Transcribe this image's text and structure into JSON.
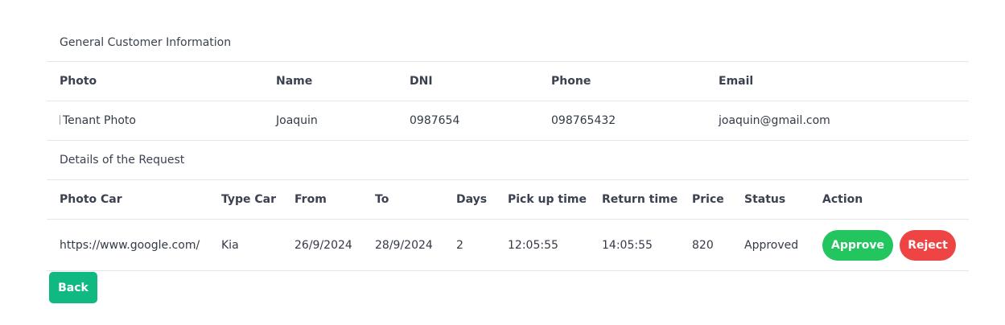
{
  "customer_section": {
    "title": "General Customer Information",
    "headers": {
      "photo": "Photo",
      "name": "Name",
      "dni": "DNI",
      "phone": "Phone",
      "email": "Email"
    },
    "values": {
      "photo_alt": "Tenant Photo",
      "name": "Joaquin",
      "dni": "0987654",
      "phone": "098765432",
      "email": "joaquin@gmail.com"
    }
  },
  "request_section": {
    "title": "Details of the Request",
    "headers": {
      "photo_car": "Photo Car",
      "type_car": "Type Car",
      "from": "From",
      "to": "To",
      "days": "Days",
      "pick_up_time": "Pick up time",
      "return_time": "Return time",
      "price": "Price",
      "status": "Status",
      "action": "Action"
    },
    "values": {
      "photo_car": "https://www.google.com/",
      "type_car": "Kia",
      "from": "26/9/2024",
      "to": "28/9/2024",
      "days": "2",
      "pick_up_time": "12:05:55",
      "return_time": "14:05:55",
      "price": "820",
      "status": "Approved"
    },
    "actions": {
      "approve_label": "Approve",
      "reject_label": "Reject"
    }
  },
  "footer": {
    "back_label": "Back"
  },
  "colors": {
    "approve": "#22c55e",
    "reject": "#ef4444",
    "back": "#10b981",
    "divider": "#e3e6ea"
  }
}
